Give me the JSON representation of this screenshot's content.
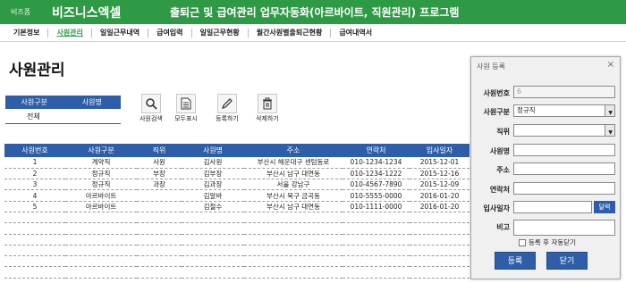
{
  "header": {
    "brand_small": "비즈폼",
    "brand_big": "비즈니스엑셀",
    "title": "출퇴근 및 급여관리 업무자동화(아르바이트, 직원관리) 프로그램"
  },
  "menu": [
    "기본정보",
    "사원관리",
    "일일근무내역",
    "급여입력",
    "일일근무현황",
    "월간사원별출퇴근현황",
    "급여내역서"
  ],
  "menu_active_index": 1,
  "page_title": "사원관리",
  "filter": {
    "col1": "사원구분",
    "col2": "사원명",
    "value": "전체"
  },
  "toolbar": {
    "search": "사원검색",
    "show_all": "모두표시",
    "register": "등록하기",
    "delete": "삭제하기"
  },
  "table": {
    "columns": [
      "사원번호",
      "사원구분",
      "직위",
      "사원명",
      "주소",
      "연락처",
      "입사일자"
    ],
    "rows": [
      [
        "1",
        "계약직",
        "사원",
        "김사원",
        "부산시 해운대구 센텀동로",
        "010-1234-1234",
        "2015-12-01"
      ],
      [
        "2",
        "정규직",
        "부장",
        "김부장",
        "부산시 남구 대연동",
        "010-1234-1222",
        "2015-12-16"
      ],
      [
        "3",
        "정규직",
        "과장",
        "김과장",
        "서울 강남구",
        "010-4567-7890",
        "2015-12-09"
      ],
      [
        "4",
        "아르바이트",
        "",
        "김알바",
        "부산시 북구 금곡동",
        "010-5555-0000",
        "2016-01-20"
      ],
      [
        "5",
        "아르바이트",
        "",
        "김철수",
        "부산시 남구 대연동",
        "010-1111-0000",
        "2016-01-20"
      ]
    ],
    "empty_rows": 6
  },
  "dialog": {
    "title": "사원 등록",
    "close": "×",
    "fields": {
      "emp_no_label": "사원번호",
      "emp_no_value": "6",
      "type_label": "사원구분",
      "type_value": "정규직",
      "position_label": "직위",
      "position_value": "",
      "name_label": "사원명",
      "address_label": "주소",
      "contact_label": "연락처",
      "join_label": "입사일자",
      "calendar_label": "달력",
      "memo_label": "비고"
    },
    "auto_close_label": "등록 후 자동닫기",
    "register_button": "등록",
    "close_button": "닫기"
  },
  "colors": {
    "header_green": "#2f9a45",
    "table_blue": "#2f5ea8"
  }
}
